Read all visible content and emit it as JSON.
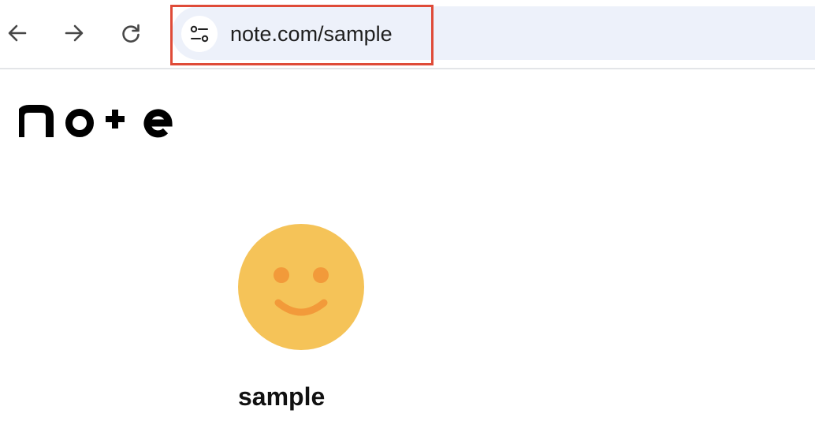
{
  "browser": {
    "back_icon": "arrow-left-icon",
    "forward_icon": "arrow-right-icon",
    "reload_icon": "reload-icon",
    "site_info_icon": "tune-icon",
    "url": "note.com/sample",
    "omnibox_bg": "#edf1fa",
    "highlight_color": "#df4b38"
  },
  "page": {
    "logo_text": "note",
    "avatar_icon": "smiley-face-icon",
    "avatar_color": "#f5c358",
    "avatar_feature_color": "#f29a3a",
    "username": "sample"
  }
}
